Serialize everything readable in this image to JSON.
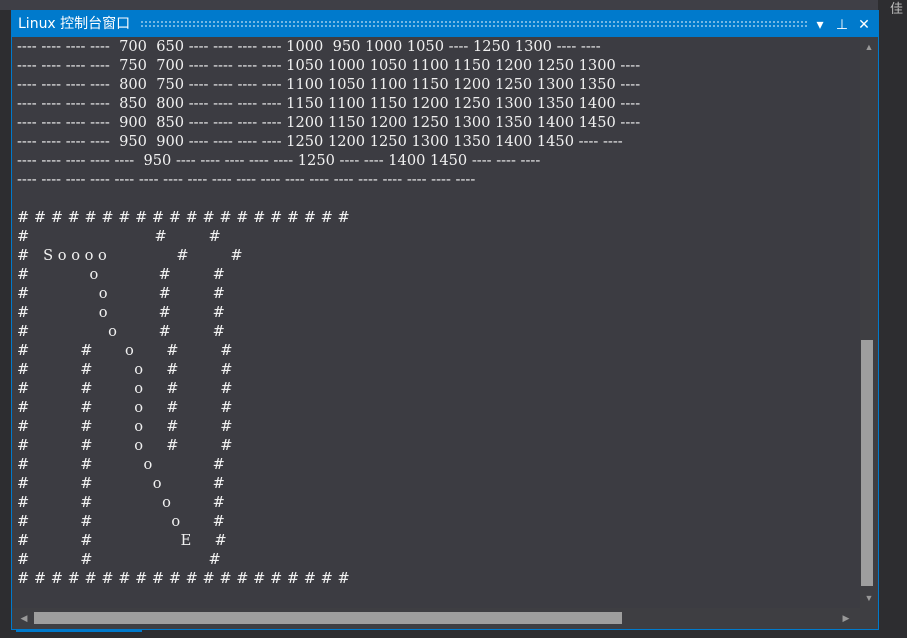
{
  "window": {
    "title": "Linux 控制台窗口",
    "right_edge_char": "佳",
    "buttons": {
      "dropdown": "▾",
      "pin": "⊥",
      "close": "✕"
    }
  },
  "console": {
    "lines": [
      "---- ---- ---- ----  700  650 ---- ---- ---- ---- 1000  950 1000 1050 ---- 1250 1300 ---- ----",
      "---- ---- ---- ----  750  700 ---- ---- ---- ---- 1050 1000 1050 1100 1150 1200 1250 1300 ----",
      "---- ---- ---- ----  800  750 ---- ---- ---- ---- 1100 1050 1100 1150 1200 1250 1300 1350 ----",
      "---- ---- ---- ----  850  800 ---- ---- ---- ---- 1150 1100 1150 1200 1250 1300 1350 1400 ----",
      "---- ---- ---- ----  900  850 ---- ---- ---- ---- 1200 1150 1200 1250 1300 1350 1400 1450 ----",
      "---- ---- ---- ----  950  900 ---- ---- ---- ---- 1250 1200 1250 1300 1350 1400 1450 ---- ----",
      "---- ---- ---- ---- ----  950 ---- ---- ---- ---- ---- 1250 ---- ---- 1400 1450 ---- ---- ----",
      "---- ---- ---- ---- ---- ---- ---- ---- ---- ---- ---- ---- ---- ---- ---- ---- ---- ---- ----",
      "",
      "# # # # # # # # # # # # # # # # # # # #",
      "#                           #         #",
      "#   S o o o o               #         #",
      "#             o             #         #",
      "#               o           #         #",
      "#               o           #         #",
      "#                 o         #         #",
      "#           #       o       #         #",
      "#           #         o     #         #",
      "#           #         o     #         #",
      "#           #         o     #         #",
      "#           #         o     #         #",
      "#           #         o     #         #",
      "#           #           o             #",
      "#           #             o           #",
      "#           #               o         #",
      "#           #                 o       #",
      "#           #                   E     #",
      "#           #                         #",
      "# # # # # # # # # # # # # # # # # # # #"
    ]
  },
  "scrollbars": {
    "up": "▲",
    "down": "▼",
    "left": "◀",
    "right": "▶"
  }
}
